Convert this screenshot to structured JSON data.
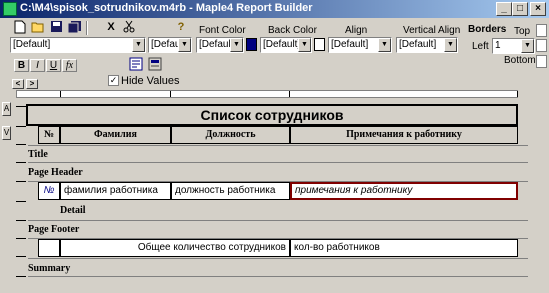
{
  "title": "C:\\M4\\spisok_sotrudnikov.m4rb - Maple4 Report Builder",
  "window_buttons": {
    "minimize": "_",
    "maximize": "□",
    "close": "×"
  },
  "toolbar": {
    "close_x": "X",
    "help": "?",
    "font_color_label": "Font Color",
    "back_color_label": "Back Color",
    "align_label": "Align",
    "valign_label": "Vertical Align",
    "font_name": "[Default]",
    "font_size": "[Default",
    "font_color": "[Default]",
    "back_color": "[Default]",
    "align": "[Default]",
    "valign": "[Default]",
    "bold": "B",
    "italic": "I",
    "underline": "U",
    "fx": "fx",
    "font_color_swatch": "#000080",
    "back_color_swatch": "#ffffff"
  },
  "borders": {
    "title": "Borders",
    "top": "Top",
    "left": "Left",
    "left_value": "1",
    "bottom": "Bottom"
  },
  "hide_values": {
    "label": "Hide Values",
    "checked": true
  },
  "ruler": {
    "left": "<",
    "right": ">"
  },
  "side": {
    "a_button": "A",
    "v_button": "V"
  },
  "report": {
    "heading": "Список сотрудников",
    "columns": [
      "№",
      "Фамилия",
      "Должность",
      "Примечания к работнику"
    ],
    "bands": {
      "title": "Title",
      "page_header": "Page Header",
      "detail": "Detail",
      "page_footer": "Page Footer",
      "summary": "Summary"
    },
    "detail_cells": [
      "№",
      "фамилия работника",
      "должность работника",
      "примечания к работнику"
    ],
    "footer_cells": [
      "Общее количество сотрудников",
      "кол-во работников"
    ]
  }
}
